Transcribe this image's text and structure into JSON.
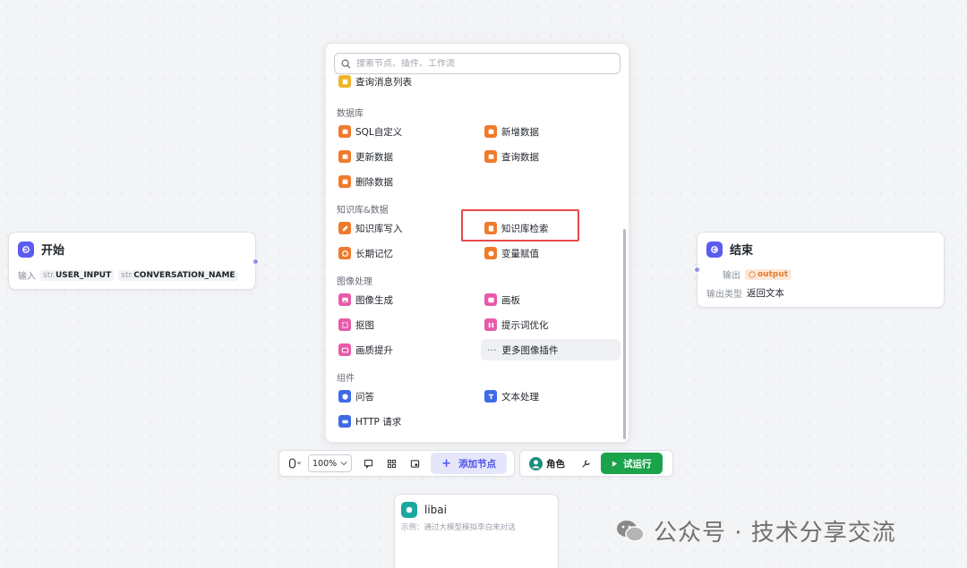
{
  "search": {
    "placeholder": "搜索节点、插件、工作流"
  },
  "panel": {
    "top_partial_item": "查询消息列表",
    "sections": [
      {
        "title": "数据库",
        "items": [
          "SQL自定义",
          "新增数据",
          "更新数据",
          "查询数据",
          "删除数据"
        ]
      },
      {
        "title": "知识库&数据",
        "items": [
          "知识库写入",
          "知识库检索",
          "长期记忆",
          "变量赋值"
        ]
      },
      {
        "title": "图像处理",
        "items": [
          "图像生成",
          "画板",
          "抠图",
          "提示词优化",
          "画质提升",
          "更多图像插件"
        ]
      },
      {
        "title": "组件",
        "items": [
          "问答",
          "文本处理",
          "HTTP 请求"
        ]
      }
    ]
  },
  "start_node": {
    "title": "开始",
    "input_label": "输入",
    "params": [
      {
        "prefix": "str.",
        "name": "USER_INPUT"
      },
      {
        "prefix": "str.",
        "name": "CONVERSATION_NAME"
      }
    ]
  },
  "end_node": {
    "title": "结束",
    "output_label": "输出",
    "output_value": "output",
    "output_type_label": "输出类型",
    "output_type_value": "返回文本"
  },
  "toolbar": {
    "zoom": "100%",
    "add_node": "添加节点",
    "role": "角色",
    "run": "试运行"
  },
  "libai_node": {
    "title": "libai",
    "desc": "示例：通过大模型模拟李白来对话"
  },
  "watermark": "公众号 · 技术分享交流",
  "colors": {
    "accent": "#4d53e8",
    "node_icon": "#5b5bf0",
    "db_orange": "#f07a2c",
    "image_pink": "#e85aa9",
    "component_blue": "#3f6ae6",
    "run_green": "#1aa34a",
    "highlight_red": "#e74a4a"
  }
}
